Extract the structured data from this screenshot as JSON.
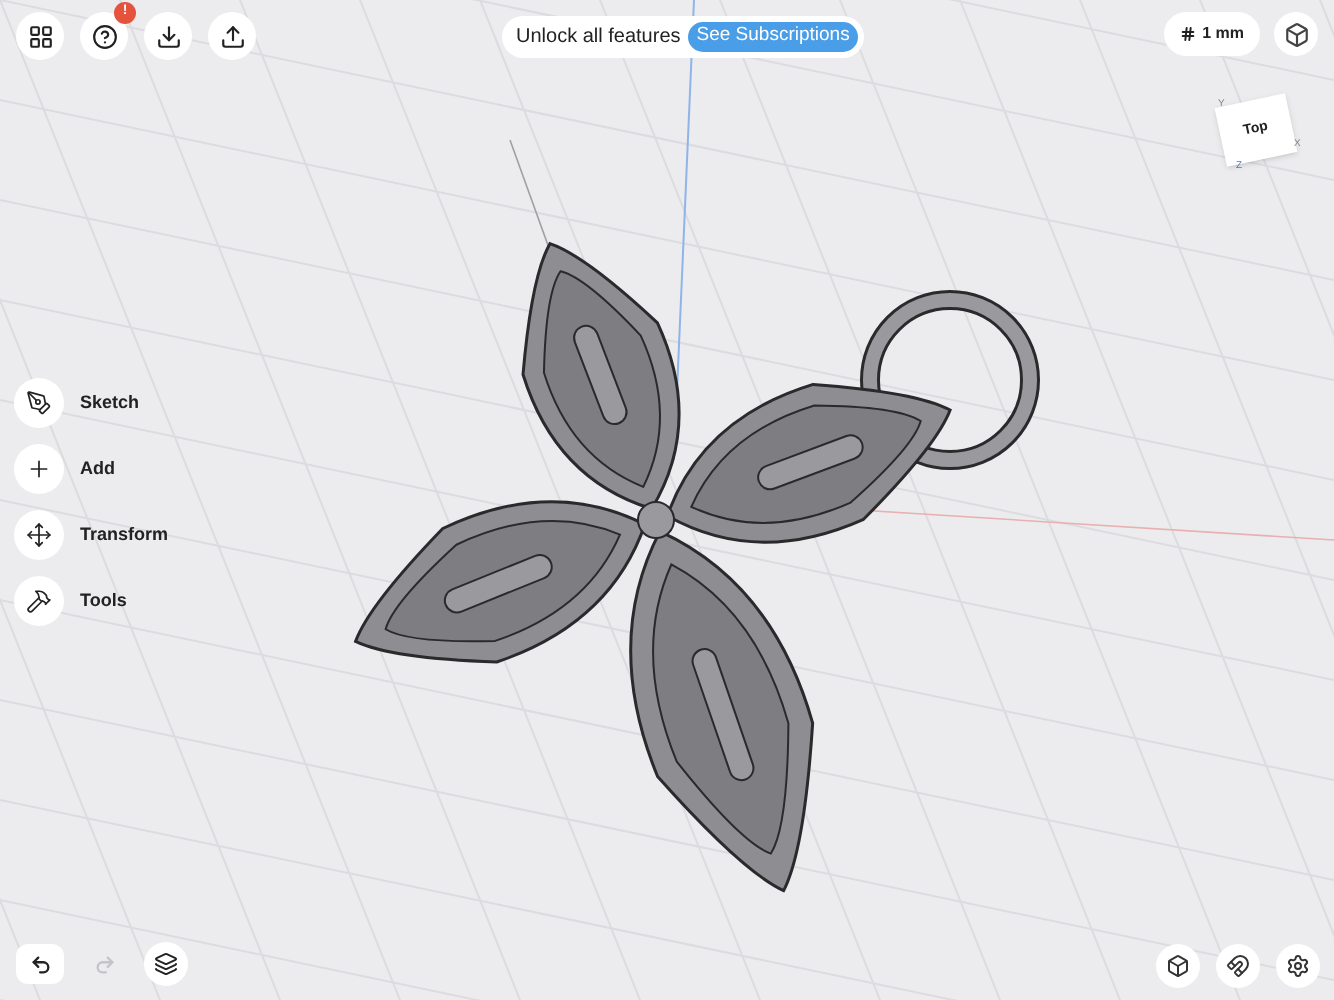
{
  "top_left_buttons": [
    {
      "kind": "grid"
    },
    {
      "kind": "help",
      "badge": "!"
    },
    {
      "kind": "import"
    },
    {
      "kind": "export"
    }
  ],
  "banner": {
    "text": "Unlock all features",
    "button": "See Subscriptions"
  },
  "grid_size": {
    "label": "1 mm"
  },
  "view_cube": {
    "face": "Top",
    "axes": [
      "Y",
      "X",
      "Z"
    ]
  },
  "tools": [
    {
      "kind": "sketch",
      "label": "Sketch"
    },
    {
      "kind": "add",
      "label": "Add"
    },
    {
      "kind": "transform",
      "label": "Transform"
    },
    {
      "kind": "tools",
      "label": "Tools"
    }
  ],
  "bottom_left": {
    "undo": {
      "disabled": false
    },
    "redo": {
      "disabled": true
    }
  },
  "bottom_right": [
    {
      "kind": "render"
    },
    {
      "kind": "snap"
    },
    {
      "kind": "settings"
    }
  ]
}
